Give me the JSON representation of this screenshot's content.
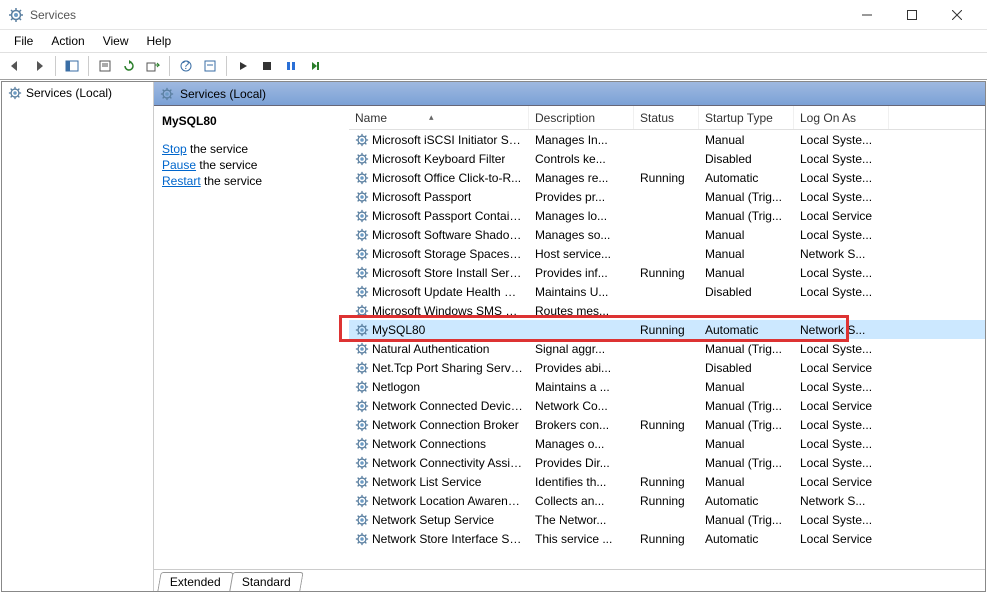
{
  "window": {
    "title": "Services"
  },
  "menu": [
    "File",
    "Action",
    "View",
    "Help"
  ],
  "leftpane": {
    "node": "Services (Local)"
  },
  "pane_header": "Services (Local)",
  "detail": {
    "service_name": "MySQL80",
    "stop_link": "Stop",
    "stop_rest": " the service",
    "pause_link": "Pause",
    "pause_rest": " the service",
    "restart_link": "Restart",
    "restart_rest": " the service"
  },
  "columns": {
    "name": "Name",
    "description": "Description",
    "status": "Status",
    "startup": "Startup Type",
    "logon": "Log On As"
  },
  "tabs": {
    "extended": "Extended",
    "standard": "Standard"
  },
  "services": [
    {
      "name": "Microsoft iSCSI Initiator Ser...",
      "desc": "Manages In...",
      "status": "",
      "startup": "Manual",
      "logon": "Local Syste..."
    },
    {
      "name": "Microsoft Keyboard Filter",
      "desc": "Controls ke...",
      "status": "",
      "startup": "Disabled",
      "logon": "Local Syste..."
    },
    {
      "name": "Microsoft Office Click-to-R...",
      "desc": "Manages re...",
      "status": "Running",
      "startup": "Automatic",
      "logon": "Local Syste..."
    },
    {
      "name": "Microsoft Passport",
      "desc": "Provides pr...",
      "status": "",
      "startup": "Manual (Trig...",
      "logon": "Local Syste..."
    },
    {
      "name": "Microsoft Passport Container",
      "desc": "Manages lo...",
      "status": "",
      "startup": "Manual (Trig...",
      "logon": "Local Service"
    },
    {
      "name": "Microsoft Software Shadow...",
      "desc": "Manages so...",
      "status": "",
      "startup": "Manual",
      "logon": "Local Syste..."
    },
    {
      "name": "Microsoft Storage Spaces S...",
      "desc": "Host service...",
      "status": "",
      "startup": "Manual",
      "logon": "Network S..."
    },
    {
      "name": "Microsoft Store Install Service",
      "desc": "Provides inf...",
      "status": "Running",
      "startup": "Manual",
      "logon": "Local Syste..."
    },
    {
      "name": "Microsoft Update Health Se...",
      "desc": "Maintains U...",
      "status": "",
      "startup": "Disabled",
      "logon": "Local Syste..."
    },
    {
      "name": "Microsoft Windows SMS Ro...",
      "desc": "Routes mes...",
      "status": "",
      "startup": "",
      "logon": ""
    },
    {
      "name": "MySQL80",
      "desc": "",
      "status": "Running",
      "startup": "Automatic",
      "logon": "Network S...",
      "selected": true
    },
    {
      "name": "Natural Authentication",
      "desc": "Signal aggr...",
      "status": "",
      "startup": "Manual (Trig...",
      "logon": "Local Syste..."
    },
    {
      "name": "Net.Tcp Port Sharing Service",
      "desc": "Provides abi...",
      "status": "",
      "startup": "Disabled",
      "logon": "Local Service"
    },
    {
      "name": "Netlogon",
      "desc": "Maintains a ...",
      "status": "",
      "startup": "Manual",
      "logon": "Local Syste..."
    },
    {
      "name": "Network Connected Device...",
      "desc": "Network Co...",
      "status": "",
      "startup": "Manual (Trig...",
      "logon": "Local Service"
    },
    {
      "name": "Network Connection Broker",
      "desc": "Brokers con...",
      "status": "Running",
      "startup": "Manual (Trig...",
      "logon": "Local Syste..."
    },
    {
      "name": "Network Connections",
      "desc": "Manages o...",
      "status": "",
      "startup": "Manual",
      "logon": "Local Syste..."
    },
    {
      "name": "Network Connectivity Assis...",
      "desc": "Provides Dir...",
      "status": "",
      "startup": "Manual (Trig...",
      "logon": "Local Syste..."
    },
    {
      "name": "Network List Service",
      "desc": "Identifies th...",
      "status": "Running",
      "startup": "Manual",
      "logon": "Local Service"
    },
    {
      "name": "Network Location Awareness",
      "desc": "Collects an...",
      "status": "Running",
      "startup": "Automatic",
      "logon": "Network S..."
    },
    {
      "name": "Network Setup Service",
      "desc": "The Networ...",
      "status": "",
      "startup": "Manual (Trig...",
      "logon": "Local Syste..."
    },
    {
      "name": "Network Store Interface Ser...",
      "desc": "This service ...",
      "status": "Running",
      "startup": "Automatic",
      "logon": "Local Service"
    }
  ]
}
